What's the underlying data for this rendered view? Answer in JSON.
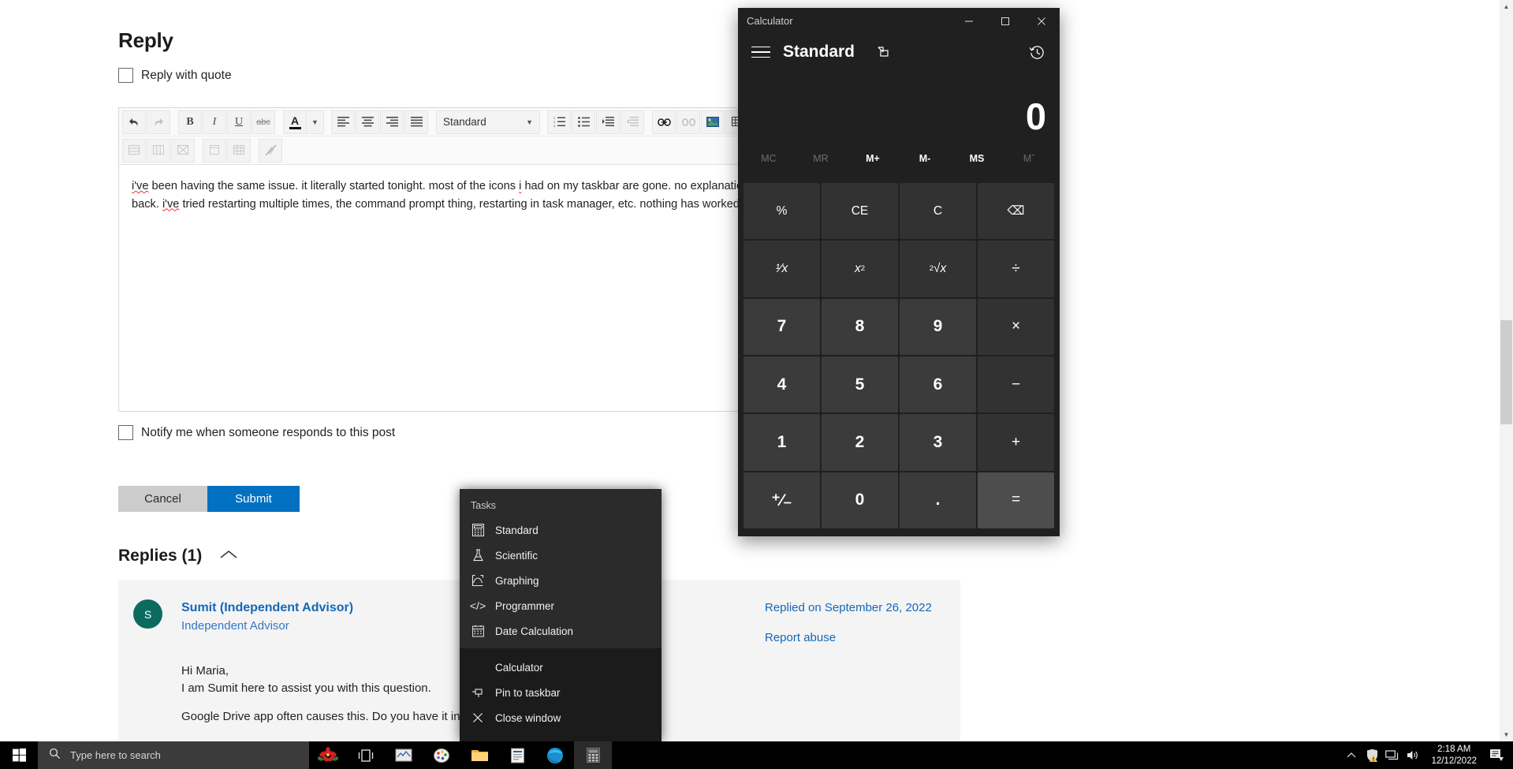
{
  "page": {
    "title": "Reply",
    "reply_with_quote_label": "Reply with quote",
    "notify_label": "Notify me when someone responds to this post",
    "editor": {
      "style_select_value": "Standard",
      "body_line1": "i've been having the same issue. it literally started tonight. most of the icons i had on my taskbar are gone. no explanation and they won't come",
      "body_line2": "back. i've tried restarting multiple times, the command prompt thing, restarting in task manager, etc. nothing has worked.",
      "toolbar_row1": [
        "undo-icon",
        "redo-icon",
        "bold-icon",
        "italic-icon",
        "underline-icon",
        "strikethrough-icon",
        "font-color-icon",
        "font-color-dropdown-icon",
        "align-left-icon",
        "align-center-icon",
        "align-right-icon",
        "align-justify-icon",
        "numbered-list-icon",
        "bulleted-list-icon",
        "indent-increase-icon",
        "indent-decrease-icon",
        "insert-link-icon",
        "remove-link-icon",
        "insert-image-icon",
        "insert-table-icon"
      ],
      "toolbar_row2": [
        "delete-row-icon",
        "delete-column-icon",
        "delete-table-icon",
        "merge-cells-icon",
        "table-properties-icon",
        "remove-format-icon"
      ]
    },
    "buttons": {
      "cancel": "Cancel",
      "submit": "Submit"
    },
    "replies": {
      "heading": "Replies (1)",
      "collapse_icon": "chevron-up-icon",
      "item": {
        "avatar_initial": "S",
        "name": "Sumit (Independent Advisor)",
        "role": "Independent Advisor",
        "date": "Replied on September 26, 2022",
        "report": "Report abuse",
        "body_line1": "Hi Maria,",
        "body_line2": "I am Sumit here to assist you with this question.",
        "body_line3": "Google Drive app often causes this. Do you have it installed?"
      }
    }
  },
  "calculator": {
    "window_title": "Calculator",
    "mode": "Standard",
    "display_value": "0",
    "window_controls": {
      "minimize": "minimize-icon",
      "maximize": "maximize-icon",
      "close": "close-icon"
    },
    "nav_icons": {
      "menu": "hamburger-icon",
      "keep_on_top": "keep-on-top-icon",
      "history": "history-icon"
    },
    "memory_buttons": [
      {
        "label": "MC",
        "enabled": false
      },
      {
        "label": "MR",
        "enabled": false
      },
      {
        "label": "M+",
        "enabled": true
      },
      {
        "label": "M-",
        "enabled": true
      },
      {
        "label": "MS",
        "enabled": true
      },
      {
        "label": "Mˇ",
        "enabled": false
      }
    ],
    "keys": [
      {
        "label": "%",
        "kind": "fn",
        "name": "percent"
      },
      {
        "label": "CE",
        "kind": "fn",
        "name": "clear-entry"
      },
      {
        "label": "C",
        "kind": "fn",
        "name": "clear"
      },
      {
        "label": "⌫",
        "kind": "fn",
        "name": "backspace"
      },
      {
        "label": "¹⁄x",
        "kind": "fn",
        "name": "reciprocal"
      },
      {
        "label": "x²",
        "kind": "fn",
        "name": "square"
      },
      {
        "label": "²√x",
        "kind": "fn",
        "name": "square-root"
      },
      {
        "label": "÷",
        "kind": "op",
        "name": "divide"
      },
      {
        "label": "7",
        "kind": "num",
        "name": "seven"
      },
      {
        "label": "8",
        "kind": "num",
        "name": "eight"
      },
      {
        "label": "9",
        "kind": "num",
        "name": "nine"
      },
      {
        "label": "×",
        "kind": "op",
        "name": "multiply"
      },
      {
        "label": "4",
        "kind": "num",
        "name": "four"
      },
      {
        "label": "5",
        "kind": "num",
        "name": "five"
      },
      {
        "label": "6",
        "kind": "num",
        "name": "six"
      },
      {
        "label": "−",
        "kind": "op",
        "name": "subtract"
      },
      {
        "label": "1",
        "kind": "num",
        "name": "one"
      },
      {
        "label": "2",
        "kind": "num",
        "name": "two"
      },
      {
        "label": "3",
        "kind": "num",
        "name": "three"
      },
      {
        "label": "+",
        "kind": "op",
        "name": "add"
      },
      {
        "label": "⁺⁄₋",
        "kind": "num",
        "name": "negate"
      },
      {
        "label": "0",
        "kind": "num",
        "name": "zero"
      },
      {
        "label": ".",
        "kind": "num",
        "name": "decimal"
      },
      {
        "label": "=",
        "kind": "eq",
        "name": "equals"
      }
    ]
  },
  "jumplist": {
    "tasks_label": "Tasks",
    "tasks": [
      {
        "label": "Standard",
        "icon": "standard-calculator-icon"
      },
      {
        "label": "Scientific",
        "icon": "flask-icon"
      },
      {
        "label": "Graphing",
        "icon": "graph-icon"
      },
      {
        "label": "Programmer",
        "icon": "code-icon"
      },
      {
        "label": "Date Calculation",
        "icon": "calendar-icon"
      }
    ],
    "actions": [
      {
        "label": "Calculator",
        "icon": ""
      },
      {
        "label": "Pin to taskbar",
        "icon": "pin-icon"
      },
      {
        "label": "Close window",
        "icon": "close-icon"
      }
    ]
  },
  "taskbar": {
    "start_icon": "windows-start-icon",
    "search_placeholder": "Type here to search",
    "search_icon": "search-icon",
    "items": [
      {
        "name": "poinsettia-flower-icon"
      },
      {
        "name": "task-view-icon"
      },
      {
        "name": "sticky-notes-icon"
      },
      {
        "name": "paint-icon"
      },
      {
        "name": "file-explorer-icon"
      },
      {
        "name": "store-icon"
      },
      {
        "name": "microsoft-edge-icon"
      },
      {
        "name": "calculator-taskbar-icon"
      }
    ],
    "tray": {
      "chevron": "show-hidden-icons-icon",
      "security": "windows-security-warning-icon",
      "network": "network-icon",
      "volume": "volume-icon",
      "time": "2:18 AM",
      "date": "12/12/2022",
      "notifications": "notifications-icon"
    }
  },
  "colors": {
    "accent": "#0271c2",
    "link": "#1468b8",
    "avatar": "#0c6b5e",
    "calc_bg": "#202020"
  }
}
